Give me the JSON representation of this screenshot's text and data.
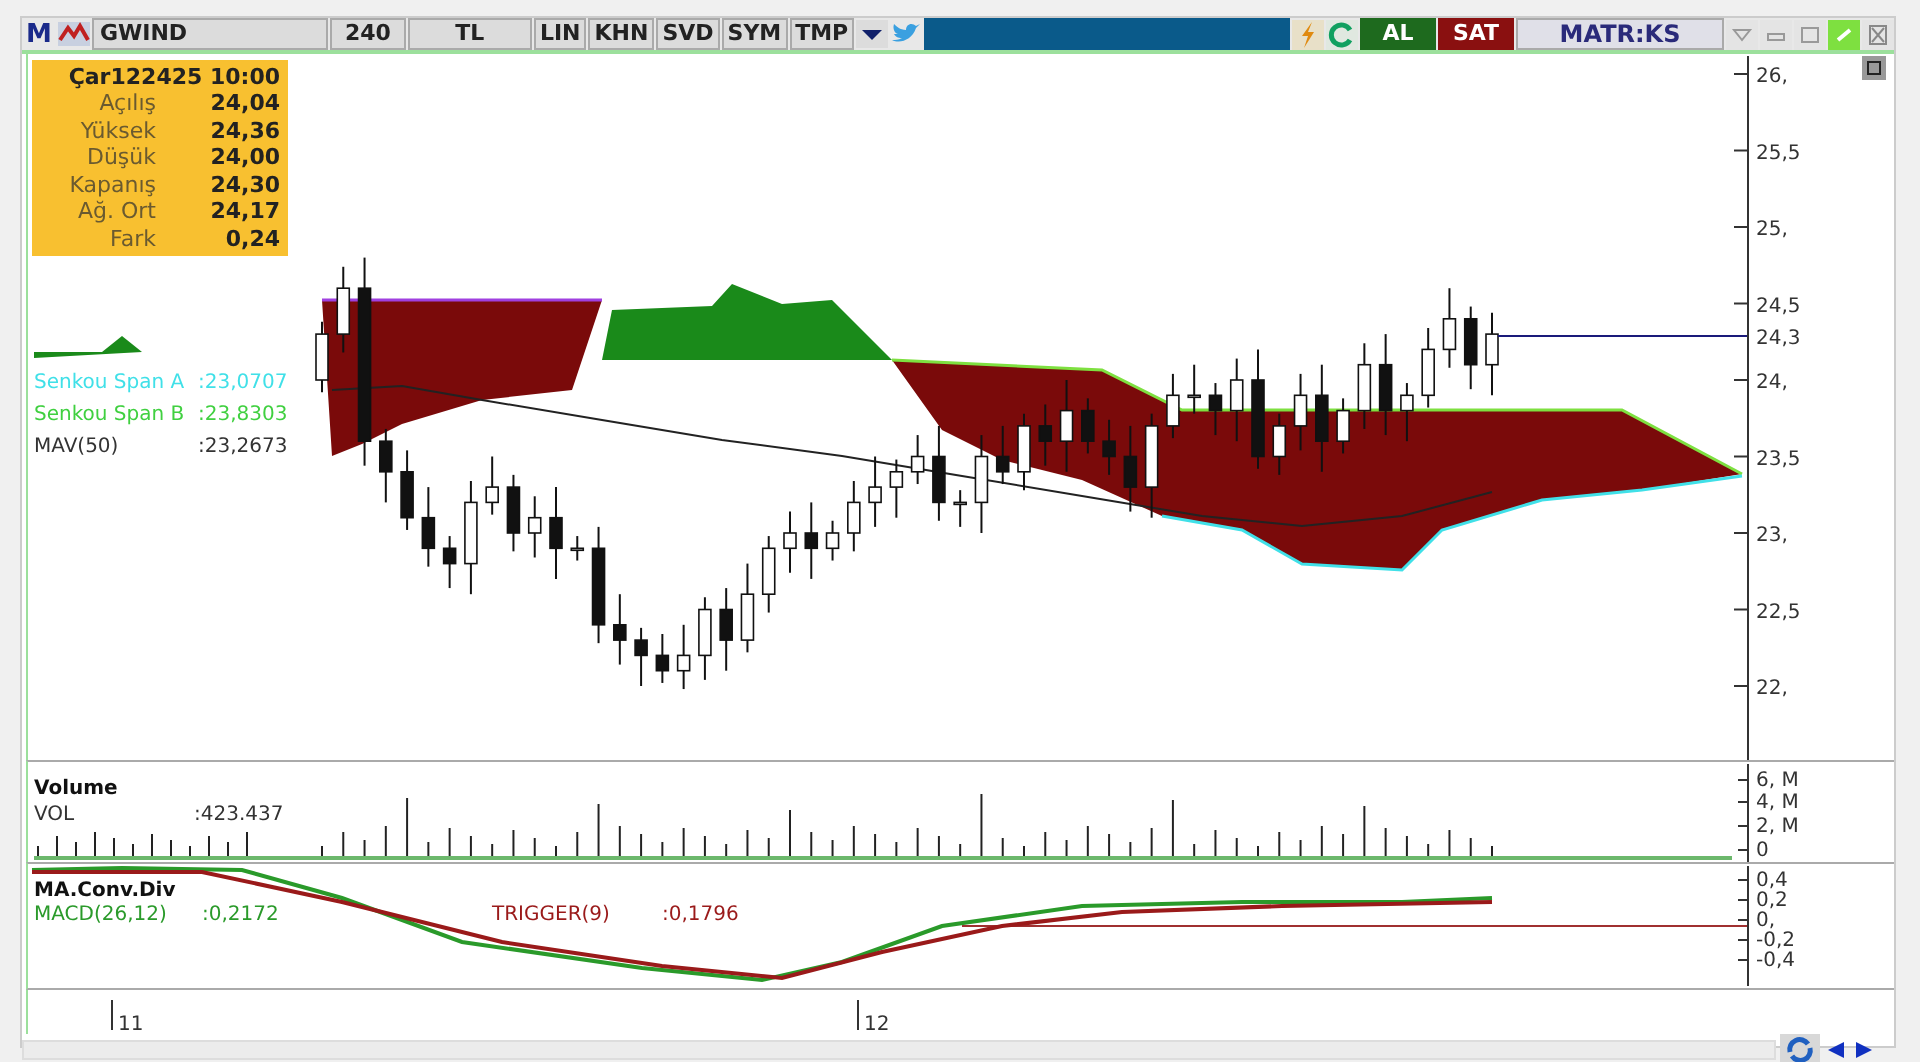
{
  "toolbar": {
    "logo": "M",
    "symbol": "GWIND",
    "period": "240",
    "currency": "TL",
    "buttons": [
      "LIN",
      "KHN",
      "SVD",
      "SYM",
      "TMP"
    ],
    "buy": "AL",
    "sell": "SAT",
    "brand": "MATR:KS"
  },
  "info_box": {
    "title": "Çar122425 10:00",
    "rows": [
      {
        "label": "Açılış",
        "value": "24,04"
      },
      {
        "label": "Yüksek",
        "value": "24,36"
      },
      {
        "label": "Düşük",
        "value": "24,00"
      },
      {
        "label": "Kapanış",
        "value": "24,30"
      },
      {
        "label": "Ağ. Ort",
        "value": "24,17"
      },
      {
        "label": "Fark",
        "value": "0,24"
      }
    ]
  },
  "legends": [
    {
      "label": "Senkou Span A",
      "value": ":23,0707",
      "color": "#40e0e8"
    },
    {
      "label": "Senkou Span B",
      "value": ":23,8303",
      "color": "#40d040"
    },
    {
      "label": "MAV(50)",
      "value": ":23,2673",
      "color": "#333333"
    }
  ],
  "price_axis": {
    "ticks": [
      "26,",
      "25,5",
      "25,",
      "24,5",
      "24,",
      "23,5",
      "23,",
      "22,5",
      "22,"
    ],
    "current": "24,3"
  },
  "volume": {
    "title": "Volume",
    "label": "VOL",
    "value": ":423.437",
    "ticks": [
      "6, M",
      "4, M",
      "2, M",
      "0"
    ]
  },
  "macd": {
    "title": "MA.Conv.Div",
    "series": [
      {
        "label": "MACD(26,12)",
        "value": ":0,2172",
        "color": "#2a9a2a"
      },
      {
        "label": "TRIGGER(9)",
        "value": ":0,1796",
        "color": "#9a1a1a"
      }
    ],
    "ticks": [
      "0,4",
      "0,2",
      "0,",
      "-0,2",
      "-0,4"
    ]
  },
  "time_axis": [
    "11",
    "12"
  ]
}
